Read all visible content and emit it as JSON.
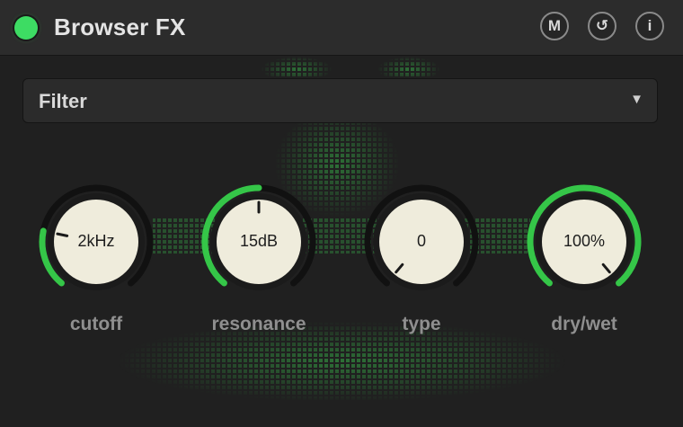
{
  "header": {
    "title": "Browser FX",
    "power_led_color": "#3ddc63",
    "buttons": [
      {
        "label": "M",
        "icon": "midi-map-icon"
      },
      {
        "label": "↺",
        "icon": "reset-icon"
      },
      {
        "label": "i",
        "icon": "info-icon"
      }
    ]
  },
  "effect_selector": {
    "selected": "Filter",
    "arrow": "▼"
  },
  "accent_color": "#35c648",
  "knobs": [
    {
      "name": "cutoff",
      "label": "cutoff",
      "value_text": "2kHz",
      "level": 0.22
    },
    {
      "name": "resonance",
      "label": "resonance",
      "value_text": "15dB",
      "level": 0.5
    },
    {
      "name": "type",
      "label": "type",
      "value_text": "0",
      "level": 0.0
    },
    {
      "name": "drywet",
      "label": "dry/wet",
      "value_text": "100%",
      "level": 1.0
    }
  ]
}
